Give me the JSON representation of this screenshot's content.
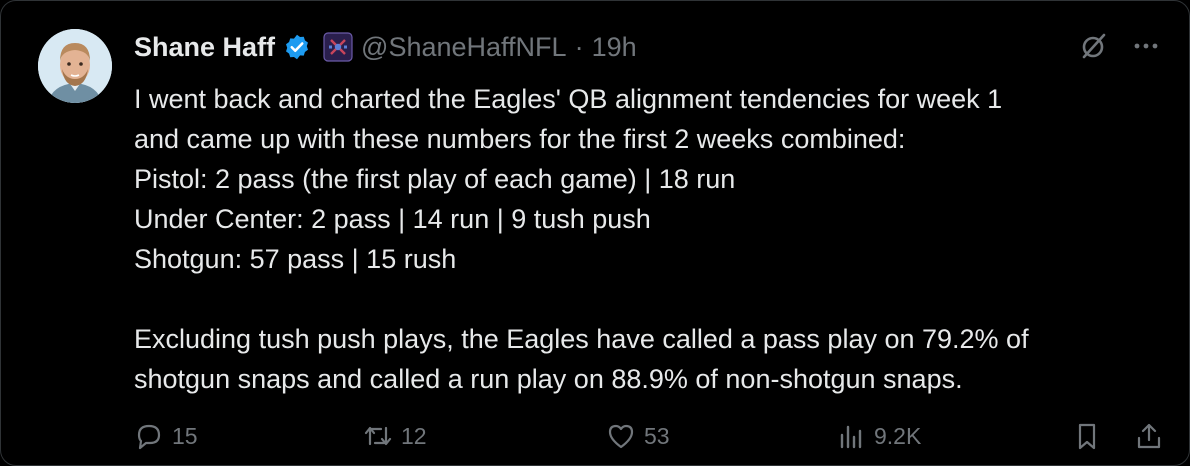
{
  "author": {
    "name": "Shane Haff",
    "handle": "@ShaneHaffNFL",
    "separator": "·",
    "time": "19h"
  },
  "body_lines": [
    "I went back and charted the Eagles' QB alignment tendencies for week 1",
    "and came up with these numbers for the first 2 weeks combined:",
    "Pistol: 2 pass (the first play of each game) | 18 run",
    "Under Center: 2 pass | 14 run | 9 tush push",
    "Shotgun: 57 pass | 15 rush",
    "",
    "Excluding tush push plays, the Eagles have called a pass play on 79.2% of",
    "shotgun snaps and called a run play on 88.9% of non-shotgun snaps."
  ],
  "actions": {
    "replies": "15",
    "reposts": "12",
    "likes": "53",
    "views": "9.2K"
  },
  "icons": {
    "verified": "verified-badge-icon",
    "affiliate": "affiliate-badge-icon",
    "grok": "grok-icon",
    "more": "more-icon",
    "reply": "reply-icon",
    "repost": "repost-icon",
    "like": "like-icon",
    "views": "views-icon",
    "bookmark": "bookmark-icon",
    "share": "share-icon"
  },
  "colors": {
    "background": "#000000",
    "text": "#e7e9ea",
    "muted": "#71767b",
    "verified": "#1d9bf0"
  }
}
